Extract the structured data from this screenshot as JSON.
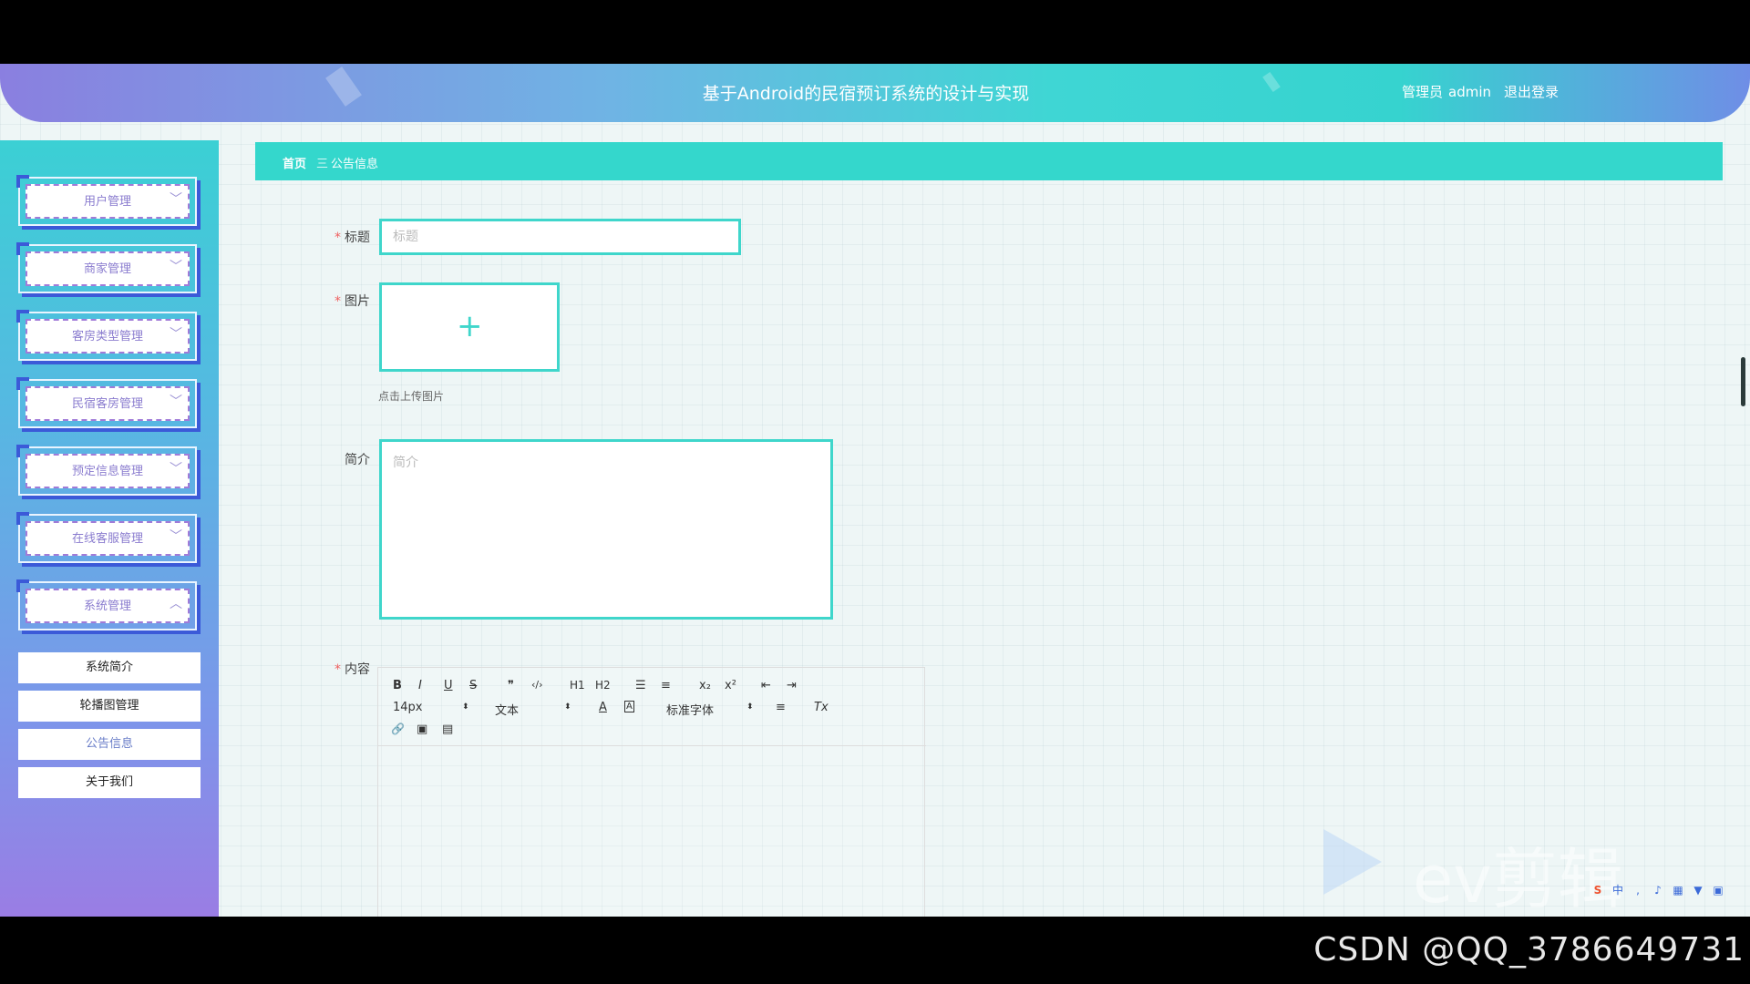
{
  "header": {
    "title": "基于Android的民宿预订系统的设计与实现",
    "user_role": "管理员",
    "username": "admin",
    "logout_label": "退出登录"
  },
  "sidebar": {
    "menus": [
      {
        "label": "用户管理",
        "expanded": false
      },
      {
        "label": "商家管理",
        "expanded": false
      },
      {
        "label": "客房类型管理",
        "expanded": false
      },
      {
        "label": "民宿客房管理",
        "expanded": false
      },
      {
        "label": "预定信息管理",
        "expanded": false
      },
      {
        "label": "在线客服管理",
        "expanded": false
      },
      {
        "label": "系统管理",
        "expanded": true
      }
    ],
    "submenu": [
      {
        "label": "系统简介"
      },
      {
        "label": "轮播图管理"
      },
      {
        "label": "公告信息"
      },
      {
        "label": "关于我们"
      }
    ]
  },
  "breadcrumb": {
    "home": "首页",
    "separator": "三",
    "current": "公告信息"
  },
  "form": {
    "title_label": "标题",
    "title_placeholder": "标题",
    "image_label": "图片",
    "image_plus": "+",
    "upload_hint": "点击上传图片",
    "intro_label": "简介",
    "intro_placeholder": "简介",
    "content_label": "内容",
    "required_mark": "*"
  },
  "editor": {
    "buttons": [
      "B",
      "I",
      "U",
      "S",
      "❞",
      "‹/›",
      "H1",
      "H2",
      "☰",
      "≡",
      "x₂",
      "x²",
      "⇤",
      "⇥"
    ],
    "font_size": "14px",
    "header_select": "文本",
    "font_family_select": "标准字体",
    "font_color": "A",
    "bg_color": "A",
    "align": "≡",
    "clean": "Tx",
    "link": "🔗",
    "image": "▣",
    "video": "▤"
  },
  "overlay": {
    "watermark": "CSDN @QQ_3786649731",
    "ev_text": "ev剪辑"
  },
  "colors": {
    "accent": "#34d7cc",
    "sidebar_top": "#3bd0d4",
    "sidebar_bottom": "#9a7de4",
    "menu_text": "#8a7ccf",
    "required": "#ef5f5f"
  }
}
